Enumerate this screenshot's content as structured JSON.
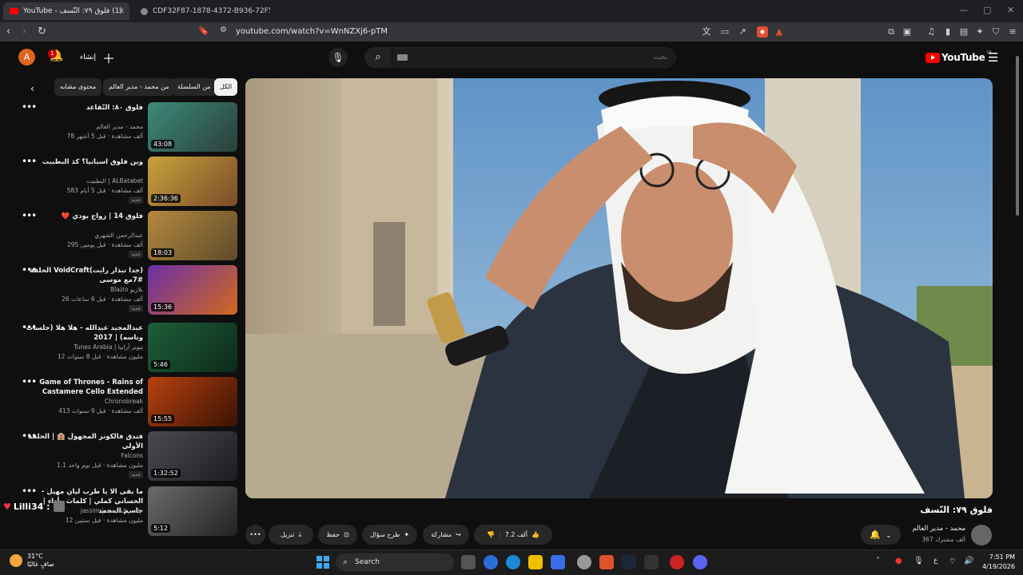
{
  "browser": {
    "tabs": [
      {
        "label": "(1) فلوق ٧٩: النّسف - YouTube",
        "active": true
      },
      {
        "label": "CDF32F87-1878-4372-B936-72F512",
        "active": false
      }
    ],
    "url": "youtube.com/watch?v=WnNZXj6-pTM"
  },
  "header": {
    "avatar_letter": "A",
    "notifications_count": "1",
    "create_label": "إنشاء",
    "search_placeholder": "بحث",
    "logo_text": "YouTube",
    "logo_region": "SA"
  },
  "chips": [
    "الكل",
    "من السلسلة",
    "من محمد - مدير العالم",
    "محتوى مشابه"
  ],
  "recommendations": [
    {
      "title": "فلوق ٨٠: التّقاعد",
      "channel": "محمد - مدير العالم",
      "meta": "78 ألف مشاهدة · قبل 5 أشهر",
      "duration": "43:08",
      "new": "",
      "colors": [
        "#3c8a7a",
        "#2b3f3a"
      ]
    },
    {
      "title": "وين فلوق اسبانيا؟ كذ البطبيت",
      "channel": "البطبيت | ALBatabet",
      "meta": "583 ألف مشاهدة · قبل 5 أيام",
      "duration": "2:36:36",
      "new": "جديد",
      "colors": [
        "#c9a23b",
        "#7a4b2a"
      ]
    },
    {
      "title": "فلوق 14 | زواج بودي ❤️",
      "channel": "عبدالرحمن الشهري",
      "meta": "295 ألف مشاهدة · قبل يومين",
      "duration": "18:03",
      "new": "جديد",
      "colors": [
        "#b58a3f",
        "#5e4a2a"
      ]
    },
    {
      "title": "(جدا تيذار رايت)VoidCraft الحلقة #7مع موسى",
      "channel": "Blazio بلازيو",
      "meta": "26 ألف مشاهدة · قبل 6 ساعات",
      "duration": "15:36",
      "new": "جديد",
      "colors": [
        "#6a2ea6",
        "#d2691e"
      ]
    },
    {
      "title": "عبدالمجيد عبدالله - هلا هلا (جلسات وناسه) | 2017",
      "channel": "Tunes Arabia | تيونز أرابيا",
      "meta": "12 مليون مشاهدة · قبل 8 سنوات",
      "duration": "5:46",
      "new": "",
      "colors": [
        "#1f5e3a",
        "#0c2a1a"
      ]
    },
    {
      "title": "Game of Thrones - Rains of Castamere Cello Extended",
      "channel": "Chronobreak",
      "meta": "413 ألف مشاهدة · قبل 9 سنوات",
      "duration": "15:55",
      "new": "",
      "colors": [
        "#b8420d",
        "#3a1205"
      ]
    },
    {
      "title": "فندق فالكونز المجهول 🏨 | الحلقة الأولى",
      "channel": "Falcons",
      "meta": "1.1 مليون مشاهدة · قبل يوم واحد",
      "duration": "1:32:52",
      "new": "جديد",
      "colors": [
        "#4a4a52",
        "#1c1c22"
      ]
    },
    {
      "title": "ما بقى الا يا طرب ليان مهيل - الحساني كملي | كلمات وأداء | جاسم المحمد",
      "channel": "jassim | جاسم المحيميد",
      "meta": "12 مليون مشاهدة · قبل سنتين",
      "duration": "5:12",
      "new": "",
      "colors": [
        "#6b6b6b",
        "#222"
      ]
    }
  ],
  "video": {
    "title": "فلوق ٧٩: النّسف",
    "channel_name": "محمد - مدير العالم",
    "channel_subs": "367 ألف مشترك",
    "likes": "7.2 ألف",
    "share_label": "مشاركة",
    "ask_label": "طرح سؤال",
    "save_label": "حفظ",
    "download_label": "تنزيل"
  },
  "overlay": {
    "text": "Lilli34 :"
  },
  "taskbar": {
    "weather_temp": "31°C",
    "weather_desc": "صافٍ غالبًا",
    "search_label": "Search",
    "time": "7:51 PM",
    "date": "4/19/2026"
  }
}
